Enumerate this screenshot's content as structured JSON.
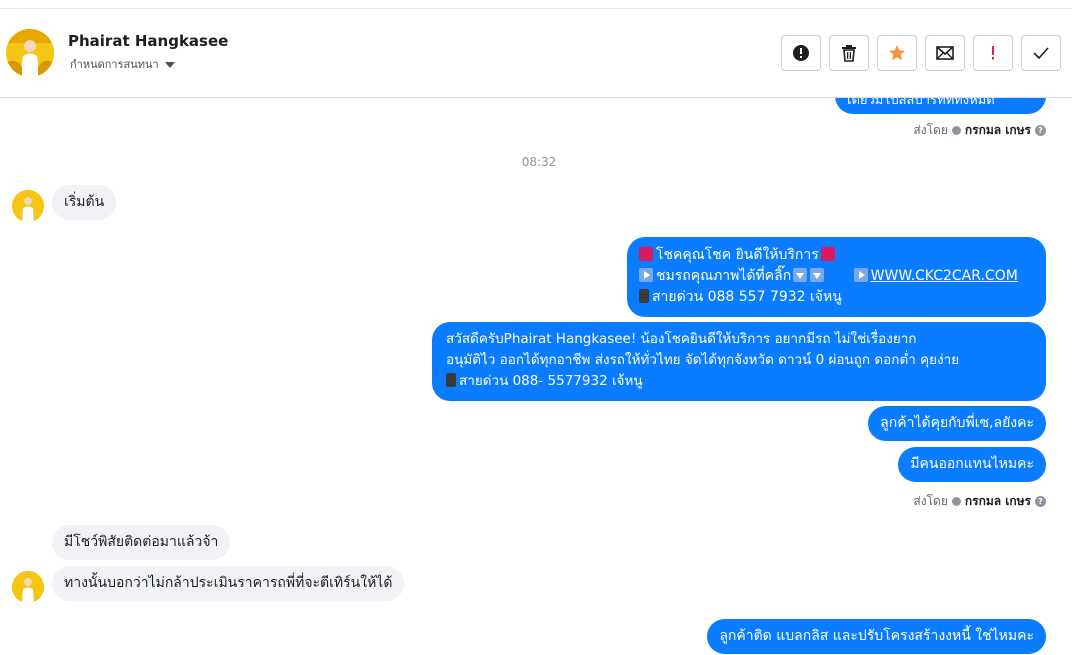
{
  "header": {
    "contact_name": "Phairat Hangkasee",
    "assign_label": "กำหนดการสนทนา"
  },
  "toolbar": {
    "icons": [
      "alert-icon",
      "trash-icon",
      "star-icon",
      "mail-icon",
      "spam-icon",
      "check-icon"
    ],
    "star_color": "#f7923a",
    "spam_color": "#e41e3f"
  },
  "chat": {
    "top_partial_text": "เตียวมีโปสสิบาร์ท์ที่ทั้งหมด",
    "sent_by_1": {
      "prefix": "ส่งโดย",
      "name": "กรกมล เกษร"
    },
    "timestamp": "08:32",
    "msg_start": "เริ่มต้น",
    "msg_welcome": {
      "line1": "โชคคุณโชค ยินดีให้บริการ",
      "line2a": "ชมรถคุณภาพได้ที่คลิ๊ก",
      "link": "WWW.CKC2CAR.COM",
      "line3": "สายด่วน 088 557 7932 เจ้หนู"
    },
    "msg_greeting": {
      "line1": "สวัสดีครับPhairat Hangkasee! น้องโชคยินดีให้บริการ อยากมีรถ ไม่ใช่เรื่องยาก",
      "line2": "อนุมัติไว ออกได้ทุกอาชีพ ส่งรถให้ทั่วไทย จัดได้ทุกจังหวัด ดาวน์ 0  ผ่อนถูก ดอกต่ำ คุยง่าย",
      "line3": "สายด่วน 088- 5577932 เจ้หนู"
    },
    "msg_ask1": "ลูกค้าได้คุยกับพี่เซ,ลยังคะ",
    "msg_ask2": "มีคนออกแทนไหมคะ",
    "sent_by_2": {
      "prefix": "ส่งโดย",
      "name": "กรกมล เกษร"
    },
    "msg_in_1": "มีโชว์พิสัยติดต่อมาแล้วจ้า",
    "msg_in_2": "ทางนั้นบอกว่าไม่กล้าประเมินราคารถพี่ที่จะตีเทิร์นให้ได้",
    "msg_out_last": "ลูกค้าติด แบลกลิส และปรับโครงสร้างงหนี้ ใช่ไหมคะ"
  }
}
